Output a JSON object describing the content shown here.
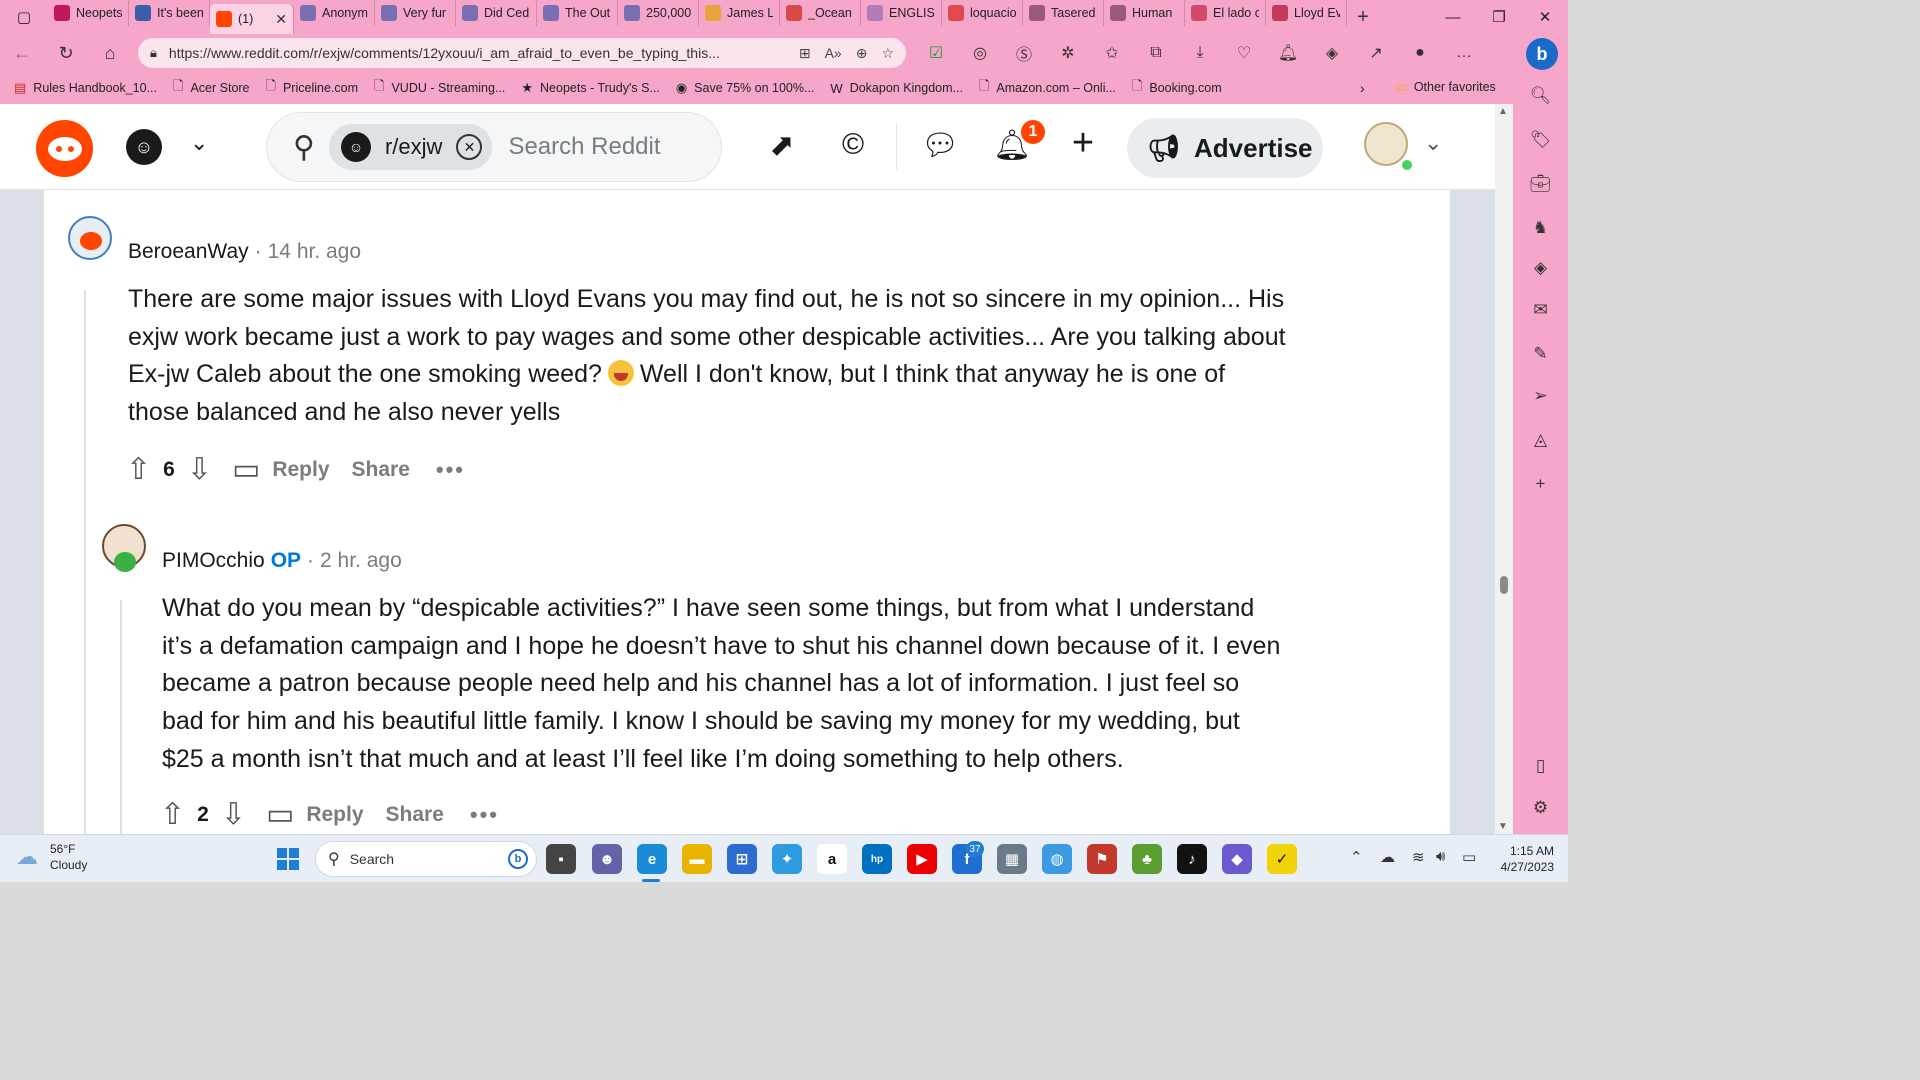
{
  "browser": {
    "tabs": [
      {
        "title": "Neopets",
        "favicon_color": "#c2185b",
        "icon": "star"
      },
      {
        "title": "It's been",
        "favicon_color": "#3a5fa8",
        "icon": "people"
      },
      {
        "title": "(1)",
        "favicon_color": "#ff4500",
        "icon": "reddit",
        "active": true
      },
      {
        "title": "Anonym",
        "favicon_color": "#7b6fb3",
        "icon": "people"
      },
      {
        "title": "Very fur",
        "favicon_color": "#7b6fb3",
        "icon": "people"
      },
      {
        "title": "Did Ced",
        "favicon_color": "#7b6fb3",
        "icon": "people"
      },
      {
        "title": "The Out",
        "favicon_color": "#7b6fb3",
        "icon": "people"
      },
      {
        "title": "250,000",
        "favicon_color": "#7b6fb3",
        "icon": "people"
      },
      {
        "title": "James L",
        "favicon_color": "#e8a33d",
        "icon": "arch"
      },
      {
        "title": "_Ocean",
        "favicon_color": "#d84a4a",
        "icon": "pdf"
      },
      {
        "title": "ENGLISH",
        "favicon_color": "#b17bb8",
        "icon": "jw"
      },
      {
        "title": "loquacio",
        "favicon_color": "#e04a4a",
        "icon": "google"
      },
      {
        "title": "Tasered",
        "favicon_color": "#9a5a7a",
        "icon": "skull"
      },
      {
        "title": "Human",
        "favicon_color": "#9a5a7a",
        "icon": "skull"
      },
      {
        "title": "El lado c",
        "favicon_color": "#d24a6a",
        "icon": "lt"
      },
      {
        "title": "Lloyd Ev",
        "favicon_color": "#c43a5a",
        "icon": "patreon"
      }
    ],
    "url": "https://www.reddit.com/r/exjw/comments/12yxouu/i_am_afraid_to_even_be_typing_this...",
    "favorites": [
      {
        "label": "Rules Handbook_10...",
        "icon": "pdf-icon"
      },
      {
        "label": "Acer Store",
        "icon": "page-icon"
      },
      {
        "label": "Priceline.com",
        "icon": "page-icon"
      },
      {
        "label": "VUDU - Streaming...",
        "icon": "page-icon"
      },
      {
        "label": "Neopets - Trudy's S...",
        "icon": "star-icon"
      },
      {
        "label": "Save 75% on 100%...",
        "icon": "steam-icon"
      },
      {
        "label": "Dokapon Kingdom...",
        "icon": "wiki-icon"
      },
      {
        "label": "Amazon.com – Onli...",
        "icon": "page-icon"
      },
      {
        "label": "Booking.com",
        "icon": "page-icon"
      }
    ],
    "other_favorites": "Other favorites"
  },
  "reddit": {
    "community_chip": "r/exjw",
    "search_placeholder": "Search Reddit",
    "notification_count": "1",
    "advertise_label": "Advertise"
  },
  "comments": [
    {
      "author": "BeroeanWay",
      "age": "14 hr. ago",
      "op": "",
      "lines": [
        "There are some major issues with Lloyd Evans you may find out, he is not so sincere in my opinion... His",
        "exjw work became just a work to pay wages and some other despicable activities... Are you talking about",
        "Ex-jw Caleb about the one smoking weed?",
        "Well I don't know, but I think that anyway he is one of",
        "those balanced and he also never yells"
      ],
      "votes": "6",
      "reply_label": "Reply",
      "share_label": "Share",
      "more_label": "•••"
    },
    {
      "author": "PIMOcchio",
      "age": "2 hr. ago",
      "op": "OP",
      "lines": [
        "What do you mean by “despicable activities?” I have seen some things, but from what I understand",
        "it’s a defamation campaign and I hope he doesn’t have to shut his channel down because of it. I even",
        "became a patron because people need help and his channel has a lot of information. I just feel so",
        "bad for him and his beautiful little family. I know I should be saving my money for my wedding, but",
        "$25 a month isn’t that much and at least I’ll feel like I’m doing something to help others."
      ],
      "votes": "2",
      "reply_label": "Reply",
      "share_label": "Share",
      "more_label": "•••"
    }
  ],
  "taskbar": {
    "weather_temp": "56°F",
    "weather_desc": "Cloudy",
    "search_label": "Search",
    "badge_count": "37",
    "time": "1:15 AM",
    "date": "4/27/2023"
  }
}
